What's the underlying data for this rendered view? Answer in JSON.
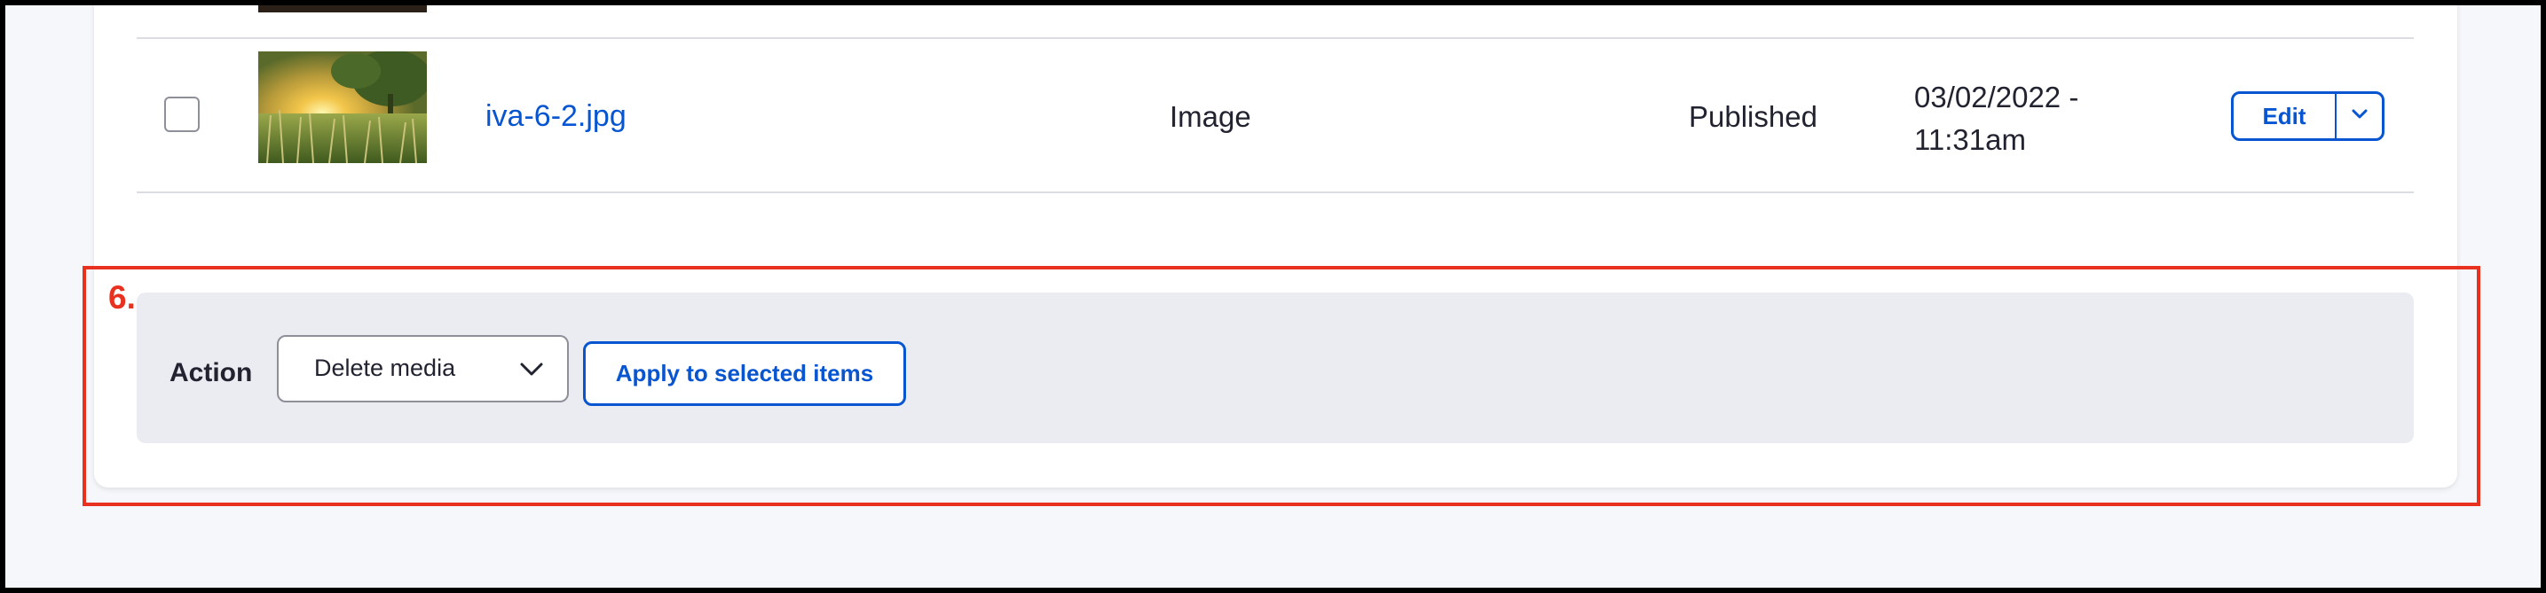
{
  "media_row": {
    "filename": "iva-6-2.jpg",
    "type": "Image",
    "status": "Published",
    "updated": "03/02/2022 - 11:31am",
    "edit_label": "Edit",
    "thumbnail_icon": "image-thumbnail"
  },
  "annotation": {
    "number": "6."
  },
  "bulk_actions": {
    "label": "Action",
    "selected_action": "Delete media",
    "apply_label": "Apply to selected items"
  },
  "colors": {
    "link": "#0755d1",
    "annotation_red": "#e8321f",
    "panel_background": "#ebecf1",
    "page_background": "#f6f7fb"
  }
}
